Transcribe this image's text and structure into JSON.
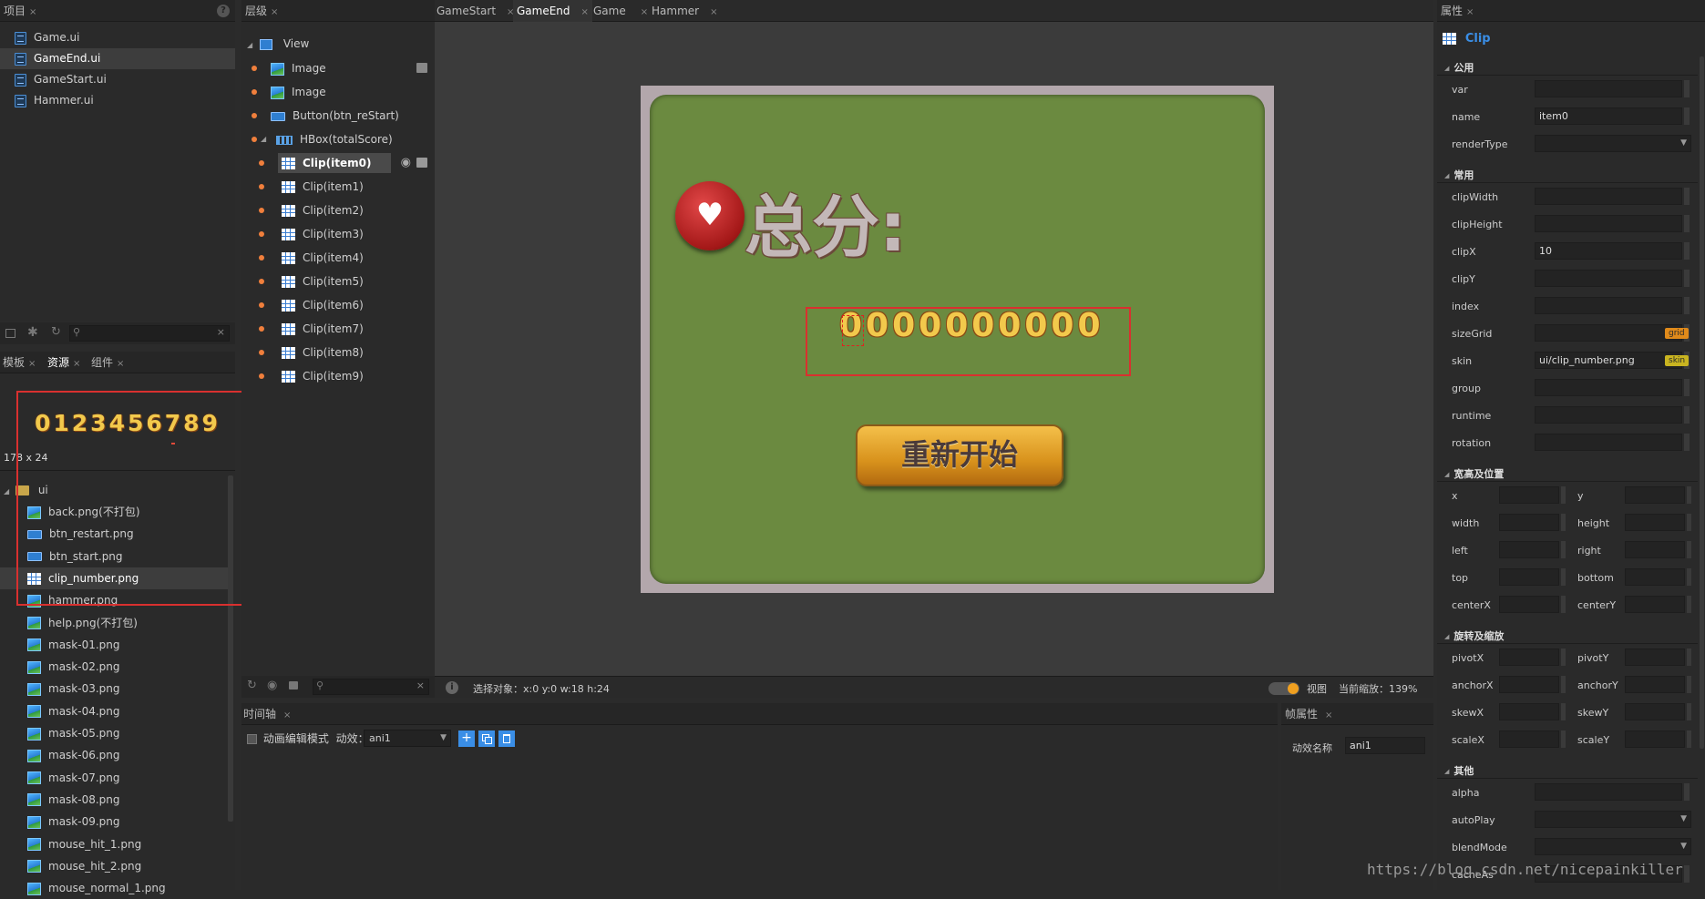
{
  "project_panel": {
    "tab": "项目",
    "files": [
      "Game.ui",
      "GameEnd.ui",
      "GameStart.ui",
      "Hammer.ui"
    ],
    "selected_index": 1
  },
  "res_panel": {
    "tabs": [
      "模板",
      "资源",
      "组件"
    ],
    "preview_digits": "0123456789",
    "preview_size": "178 x 24",
    "folder": "ui",
    "files": [
      "back.png(不打包)",
      "btn_restart.png",
      "btn_start.png",
      "clip_number.png",
      "hammer.png",
      "help.png(不打包)",
      "mask-01.png",
      "mask-02.png",
      "mask-03.png",
      "mask-04.png",
      "mask-05.png",
      "mask-06.png",
      "mask-07.png",
      "mask-08.png",
      "mask-09.png",
      "mouse_hit_1.png",
      "mouse_hit_2.png",
      "mouse_normal_1.png"
    ],
    "file_icons": [
      "img",
      "btn",
      "btn",
      "grid",
      "img",
      "img",
      "img",
      "img",
      "img",
      "img",
      "img",
      "img",
      "img",
      "img",
      "img",
      "img",
      "img",
      "img"
    ],
    "selected_index": 3
  },
  "layer_panel": {
    "tab": "层级",
    "root": "View",
    "items": [
      {
        "label": "Image",
        "icon": "img",
        "indent": 1
      },
      {
        "label": "Image",
        "icon": "img",
        "indent": 1
      },
      {
        "label": "Button(btn_reStart)",
        "icon": "btn",
        "indent": 1
      },
      {
        "label": "HBox(totalScore)",
        "icon": "hbox",
        "indent": 1
      },
      {
        "label": "Clip(item0)",
        "icon": "grid",
        "indent": 2
      },
      {
        "label": "Clip(item1)",
        "icon": "grid",
        "indent": 2
      },
      {
        "label": "Clip(item2)",
        "icon": "grid",
        "indent": 2
      },
      {
        "label": "Clip(item3)",
        "icon": "grid",
        "indent": 2
      },
      {
        "label": "Clip(item4)",
        "icon": "grid",
        "indent": 2
      },
      {
        "label": "Clip(item5)",
        "icon": "grid",
        "indent": 2
      },
      {
        "label": "Clip(item6)",
        "icon": "grid",
        "indent": 2
      },
      {
        "label": "Clip(item7)",
        "icon": "grid",
        "indent": 2
      },
      {
        "label": "Clip(item8)",
        "icon": "grid",
        "indent": 2
      },
      {
        "label": "Clip(item9)",
        "icon": "grid",
        "indent": 2
      }
    ],
    "selected_index": 4
  },
  "editor": {
    "tabs": [
      "GameStart",
      "GameEnd",
      "Game",
      "Hammer"
    ],
    "active_tab": 1,
    "canvas": {
      "title": "总分:",
      "score": "0000000000",
      "button": "重新开始"
    },
    "status": {
      "selection": "选择对象：x:0 y:0  w:18 h:24",
      "view_label": "视图",
      "zoom": "当前缩放：139%"
    }
  },
  "timeline": {
    "tab": "时间轴",
    "checkbox": "动画编辑模式",
    "effect_label": "动效：",
    "effect_value": "ani1"
  },
  "frame_props": {
    "tab": "帧属性",
    "label": "动效名称",
    "value": "ani1"
  },
  "props": {
    "tab": "属性",
    "component": "Clip",
    "sections": {
      "common": "公用",
      "usual": "常用",
      "size_pos": "宽高及位置",
      "rotate_scale": "旋转及缩放",
      "other": "其他"
    },
    "common_fields": [
      {
        "label": "var",
        "value": ""
      },
      {
        "label": "name",
        "value": "item0"
      },
      {
        "label": "renderType",
        "value": ""
      }
    ],
    "usual_fields": [
      {
        "label": "clipWidth",
        "value": ""
      },
      {
        "label": "clipHeight",
        "value": ""
      },
      {
        "label": "clipX",
        "value": "10"
      },
      {
        "label": "clipY",
        "value": ""
      },
      {
        "label": "index",
        "value": ""
      },
      {
        "label": "sizeGrid",
        "value": "",
        "tag": "grid"
      },
      {
        "label": "skin",
        "value": "ui/clip_number.png",
        "tag": "skin"
      },
      {
        "label": "group",
        "value": ""
      },
      {
        "label": "runtime",
        "value": ""
      },
      {
        "label": "rotation",
        "value": ""
      }
    ],
    "pos_rows": [
      [
        "x",
        "y"
      ],
      [
        "width",
        "height"
      ],
      [
        "left",
        "right"
      ],
      [
        "top",
        "bottom"
      ],
      [
        "centerX",
        "centerY"
      ]
    ],
    "scale_rows": [
      [
        "pivotX",
        "pivotY"
      ],
      [
        "anchorX",
        "anchorY"
      ],
      [
        "skewX",
        "skewY"
      ],
      [
        "scaleX",
        "scaleY"
      ]
    ],
    "other_fields": [
      {
        "label": "alpha",
        "value": ""
      },
      {
        "label": "autoPlay",
        "value": ""
      },
      {
        "label": "blendMode",
        "value": ""
      },
      {
        "label": "cacheAs",
        "value": ""
      }
    ]
  },
  "watermark": "https://blog.csdn.net/nicepainkiller",
  "colors": {
    "accent": "#3a8ee6",
    "highlight_box": "#d9302f",
    "canvas_green": "#6b8a40",
    "digit_gold": "#f2c94c"
  }
}
